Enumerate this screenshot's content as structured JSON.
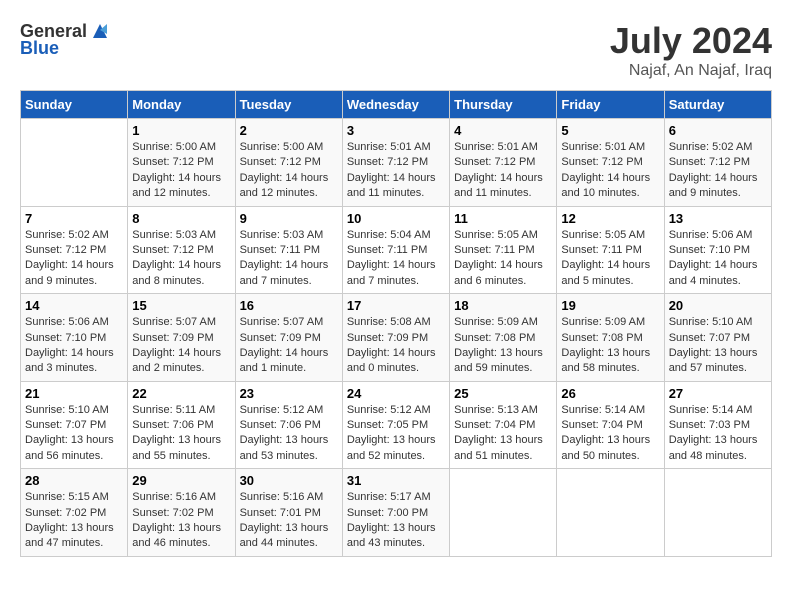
{
  "header": {
    "logo_general": "General",
    "logo_blue": "Blue",
    "title": "July 2024",
    "subtitle": "Najaf, An Najaf, Iraq"
  },
  "calendar": {
    "weekdays": [
      "Sunday",
      "Monday",
      "Tuesday",
      "Wednesday",
      "Thursday",
      "Friday",
      "Saturday"
    ],
    "weeks": [
      [
        {
          "day": "",
          "info": ""
        },
        {
          "day": "1",
          "info": "Sunrise: 5:00 AM\nSunset: 7:12 PM\nDaylight: 14 hours\nand 12 minutes."
        },
        {
          "day": "2",
          "info": "Sunrise: 5:00 AM\nSunset: 7:12 PM\nDaylight: 14 hours\nand 12 minutes."
        },
        {
          "day": "3",
          "info": "Sunrise: 5:01 AM\nSunset: 7:12 PM\nDaylight: 14 hours\nand 11 minutes."
        },
        {
          "day": "4",
          "info": "Sunrise: 5:01 AM\nSunset: 7:12 PM\nDaylight: 14 hours\nand 11 minutes."
        },
        {
          "day": "5",
          "info": "Sunrise: 5:01 AM\nSunset: 7:12 PM\nDaylight: 14 hours\nand 10 minutes."
        },
        {
          "day": "6",
          "info": "Sunrise: 5:02 AM\nSunset: 7:12 PM\nDaylight: 14 hours\nand 9 minutes."
        }
      ],
      [
        {
          "day": "7",
          "info": "Sunrise: 5:02 AM\nSunset: 7:12 PM\nDaylight: 14 hours\nand 9 minutes."
        },
        {
          "day": "8",
          "info": "Sunrise: 5:03 AM\nSunset: 7:12 PM\nDaylight: 14 hours\nand 8 minutes."
        },
        {
          "day": "9",
          "info": "Sunrise: 5:03 AM\nSunset: 7:11 PM\nDaylight: 14 hours\nand 7 minutes."
        },
        {
          "day": "10",
          "info": "Sunrise: 5:04 AM\nSunset: 7:11 PM\nDaylight: 14 hours\nand 7 minutes."
        },
        {
          "day": "11",
          "info": "Sunrise: 5:05 AM\nSunset: 7:11 PM\nDaylight: 14 hours\nand 6 minutes."
        },
        {
          "day": "12",
          "info": "Sunrise: 5:05 AM\nSunset: 7:11 PM\nDaylight: 14 hours\nand 5 minutes."
        },
        {
          "day": "13",
          "info": "Sunrise: 5:06 AM\nSunset: 7:10 PM\nDaylight: 14 hours\nand 4 minutes."
        }
      ],
      [
        {
          "day": "14",
          "info": "Sunrise: 5:06 AM\nSunset: 7:10 PM\nDaylight: 14 hours\nand 3 minutes."
        },
        {
          "day": "15",
          "info": "Sunrise: 5:07 AM\nSunset: 7:09 PM\nDaylight: 14 hours\nand 2 minutes."
        },
        {
          "day": "16",
          "info": "Sunrise: 5:07 AM\nSunset: 7:09 PM\nDaylight: 14 hours\nand 1 minute."
        },
        {
          "day": "17",
          "info": "Sunrise: 5:08 AM\nSunset: 7:09 PM\nDaylight: 14 hours\nand 0 minutes."
        },
        {
          "day": "18",
          "info": "Sunrise: 5:09 AM\nSunset: 7:08 PM\nDaylight: 13 hours\nand 59 minutes."
        },
        {
          "day": "19",
          "info": "Sunrise: 5:09 AM\nSunset: 7:08 PM\nDaylight: 13 hours\nand 58 minutes."
        },
        {
          "day": "20",
          "info": "Sunrise: 5:10 AM\nSunset: 7:07 PM\nDaylight: 13 hours\nand 57 minutes."
        }
      ],
      [
        {
          "day": "21",
          "info": "Sunrise: 5:10 AM\nSunset: 7:07 PM\nDaylight: 13 hours\nand 56 minutes."
        },
        {
          "day": "22",
          "info": "Sunrise: 5:11 AM\nSunset: 7:06 PM\nDaylight: 13 hours\nand 55 minutes."
        },
        {
          "day": "23",
          "info": "Sunrise: 5:12 AM\nSunset: 7:06 PM\nDaylight: 13 hours\nand 53 minutes."
        },
        {
          "day": "24",
          "info": "Sunrise: 5:12 AM\nSunset: 7:05 PM\nDaylight: 13 hours\nand 52 minutes."
        },
        {
          "day": "25",
          "info": "Sunrise: 5:13 AM\nSunset: 7:04 PM\nDaylight: 13 hours\nand 51 minutes."
        },
        {
          "day": "26",
          "info": "Sunrise: 5:14 AM\nSunset: 7:04 PM\nDaylight: 13 hours\nand 50 minutes."
        },
        {
          "day": "27",
          "info": "Sunrise: 5:14 AM\nSunset: 7:03 PM\nDaylight: 13 hours\nand 48 minutes."
        }
      ],
      [
        {
          "day": "28",
          "info": "Sunrise: 5:15 AM\nSunset: 7:02 PM\nDaylight: 13 hours\nand 47 minutes."
        },
        {
          "day": "29",
          "info": "Sunrise: 5:16 AM\nSunset: 7:02 PM\nDaylight: 13 hours\nand 46 minutes."
        },
        {
          "day": "30",
          "info": "Sunrise: 5:16 AM\nSunset: 7:01 PM\nDaylight: 13 hours\nand 44 minutes."
        },
        {
          "day": "31",
          "info": "Sunrise: 5:17 AM\nSunset: 7:00 PM\nDaylight: 13 hours\nand 43 minutes."
        },
        {
          "day": "",
          "info": ""
        },
        {
          "day": "",
          "info": ""
        },
        {
          "day": "",
          "info": ""
        }
      ]
    ]
  }
}
